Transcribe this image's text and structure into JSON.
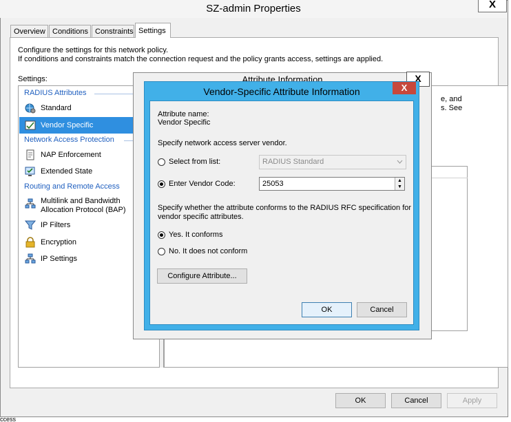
{
  "window": {
    "title": "SZ-admin Properties",
    "close_glyph": "X"
  },
  "tabs": [
    {
      "label": "Overview"
    },
    {
      "label": "Conditions"
    },
    {
      "label": "Constraints"
    },
    {
      "label": "Settings"
    }
  ],
  "intro": {
    "line1": "Configure the settings for this network policy.",
    "line2": "If conditions and constraints match the connection request and the policy grants access, settings are applied."
  },
  "settings_label": "Settings:",
  "sidebar": {
    "sections": [
      {
        "title": "RADIUS Attributes",
        "items": [
          {
            "label": "Standard",
            "icon": "globe-gear-icon"
          },
          {
            "label": "Vendor Specific",
            "icon": "checklist-icon",
            "selected": true
          }
        ]
      },
      {
        "title": "Network Access Protection",
        "items": [
          {
            "label": "NAP Enforcement",
            "icon": "document-icon"
          },
          {
            "label": "Extended State",
            "icon": "monitor-check-icon"
          }
        ]
      },
      {
        "title": "Routing and Remote Access",
        "items": [
          {
            "label": "Multilink and Bandwidth",
            "label2": "Allocation Protocol (BAP)",
            "icon": "network-icon"
          },
          {
            "label": "IP Filters",
            "icon": "funnel-icon"
          },
          {
            "label": "Encryption",
            "icon": "lock-icon"
          },
          {
            "label": "IP Settings",
            "icon": "network-icon"
          }
        ]
      }
    ]
  },
  "right_pane": {
    "partial_line1": "e, and",
    "partial_line2": "s. See"
  },
  "back_dialog": {
    "title": "Attribute Information",
    "close_glyph": "X"
  },
  "dialog": {
    "title": "Vendor-Specific Attribute Information",
    "close_glyph": "X",
    "attribute_name_label": "Attribute name:",
    "attribute_name_value": "Vendor Specific",
    "vendor_prompt": "Specify network access server vendor.",
    "select_from_list_label": "Select from list:",
    "select_value": "RADIUS Standard",
    "enter_code_label": "Enter Vendor Code:",
    "vendor_code": "25053",
    "conform_prompt_line1": "Specify whether the attribute conforms to the RADIUS RFC specification for",
    "conform_prompt_line2": "vendor specific attributes.",
    "yes_label": "Yes. It conforms",
    "no_label": "No. It does not conform",
    "configure_button": "Configure Attribute...",
    "ok_button": "OK",
    "cancel_button": "Cancel"
  },
  "footer": {
    "ok_button": "OK",
    "cancel_button": "Cancel",
    "apply_button": "Apply"
  },
  "status_strip_text": "ccess",
  "colors": {
    "accent": "#41b0e8",
    "selection": "#2f8fe0",
    "section_text": "#1f5fbf",
    "close_red": "#c7483c"
  }
}
